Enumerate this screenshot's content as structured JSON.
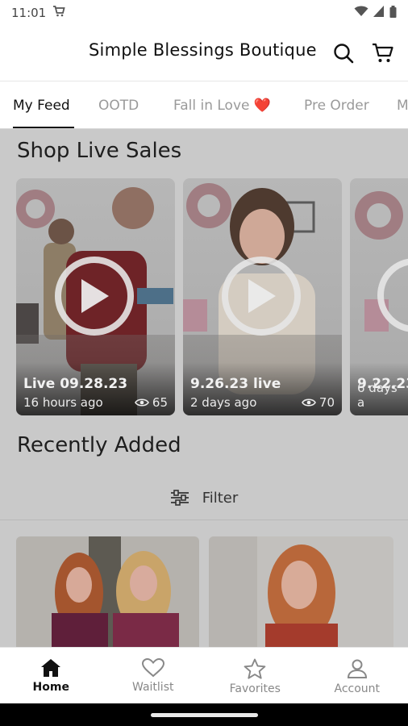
{
  "status_bar": {
    "time": "11:01"
  },
  "header": {
    "title": "Simple Blessings Boutique"
  },
  "tabs": [
    {
      "label": "My Feed"
    },
    {
      "label": "OOTD"
    },
    {
      "label": "Fall in Love ❤️"
    },
    {
      "label": "Pre Order"
    },
    {
      "label": "M"
    }
  ],
  "live_sales": {
    "title": "Shop Live Sales",
    "cards": [
      {
        "title": "Live 09.28.23",
        "time": "16 hours ago",
        "views": "65"
      },
      {
        "title": "9.26.23 live",
        "time": "2 days ago",
        "views": "70"
      },
      {
        "title": "9.22.23",
        "time": "6 days a",
        "views": ""
      }
    ]
  },
  "recently_added": {
    "title": "Recently Added",
    "filter_label": "Filter"
  },
  "bottom_nav": [
    {
      "label": "Home",
      "icon": "home-icon"
    },
    {
      "label": "Waitlist",
      "icon": "heart-icon"
    },
    {
      "label": "Favorites",
      "icon": "star-icon"
    },
    {
      "label": "Account",
      "icon": "account-icon"
    }
  ],
  "colors": {
    "overlay": "#c9c9c9",
    "accent": "#111111",
    "heart": "#e0262b"
  }
}
